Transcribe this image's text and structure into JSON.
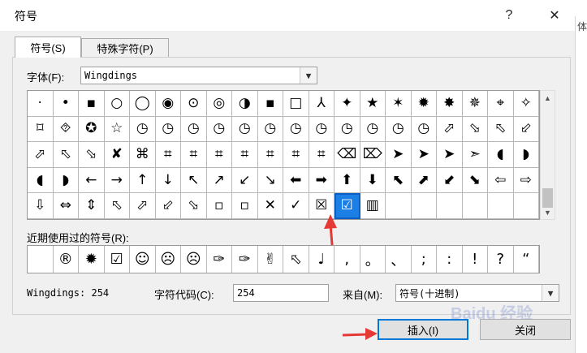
{
  "window": {
    "title": "符号",
    "help": "?",
    "close": "✕"
  },
  "background": {
    "edge_text": "体"
  },
  "tabs": [
    {
      "label": "符号(S)",
      "active": true
    },
    {
      "label": "特殊字符(P)",
      "active": false
    }
  ],
  "font": {
    "label": "字体(F):",
    "value": "Wingdings"
  },
  "symbols": [
    "·",
    "•",
    "▪",
    "○",
    "◯",
    "◉",
    "⊙",
    "◎",
    "◑",
    "▪",
    "□",
    "⅄",
    "✦",
    "★",
    "✶",
    "✹",
    "✸",
    "✵",
    "⌖",
    "✧",
    "⌑",
    "⯑",
    "✪",
    "☆",
    "◷",
    "◷",
    "◷",
    "◷",
    "◷",
    "◷",
    "◷",
    "◷",
    "◷",
    "◷",
    "◷",
    "◷",
    "⬀",
    "⬂",
    "⬁",
    "⬃",
    "⬀",
    "⬁",
    "⬂",
    "✘",
    "⌘",
    "⌗",
    "⌗",
    "⌗",
    "⌗",
    "⌗",
    "⌗",
    "⌗",
    "⌫",
    "⌦",
    "➤",
    "➤",
    "➤",
    "➣",
    "◖",
    "◗",
    "◖",
    "◗",
    "←",
    "→",
    "↑",
    "↓",
    "↖",
    "↗",
    "↙",
    "↘",
    "⬅",
    "➡",
    "⬆",
    "⬇",
    "⬉",
    "⬈",
    "⬋",
    "⬊",
    "⇦",
    "⇨",
    "⇩",
    "⇔",
    "⇕",
    "⬁",
    "⬀",
    "⬃",
    "⬂",
    "▫",
    "▫",
    "✕",
    "✓",
    "☒",
    "☑",
    "▥",
    "",
    "",
    "",
    "",
    "",
    ""
  ],
  "selected_index": 92,
  "recent": {
    "label": "近期使用过的符号(R):",
    "items": [
      "",
      "®",
      "✹",
      "☑",
      "☺",
      "☹",
      "☹",
      "✑",
      "✑",
      "✌",
      "⬁",
      "♩",
      ",",
      "。",
      "、",
      ";",
      ":",
      "!",
      "?",
      "“",
      "”"
    ]
  },
  "info": {
    "code_name": "Wingdings: 254",
    "code_label": "字符代码(C):",
    "code_value": "254",
    "from_label": "来自(M):",
    "from_value": "符号(十进制)"
  },
  "buttons": {
    "insert": "插入(I)",
    "close": "关闭"
  },
  "watermark": "Baidu 经验",
  "colors": {
    "selection": "#1b7fe6",
    "annotation": "#e53935",
    "default_button": "#0078d7"
  }
}
